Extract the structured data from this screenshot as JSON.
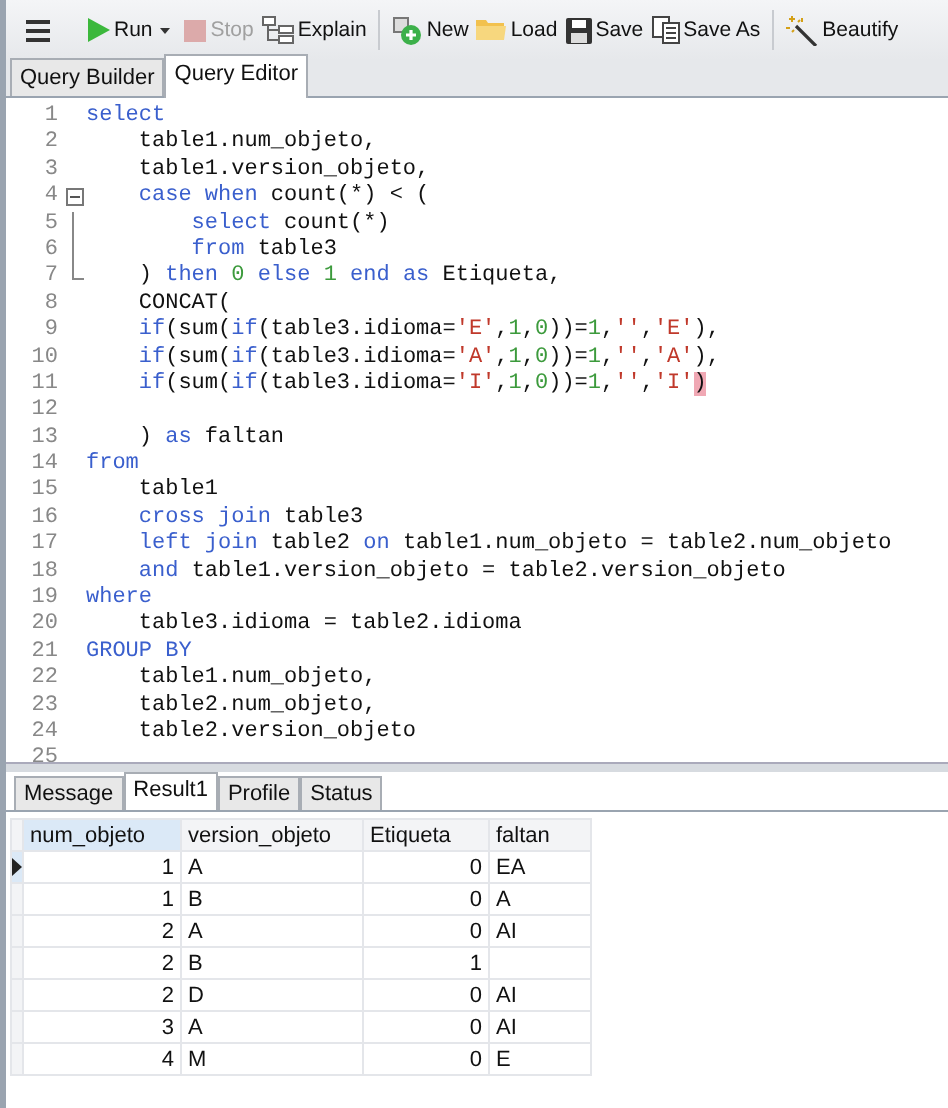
{
  "toolbar": {
    "items": [
      {
        "kind": "menu"
      },
      {
        "kind": "run",
        "label": "Run",
        "disabled": false
      },
      {
        "kind": "stop",
        "label": "Stop",
        "disabled": true
      },
      {
        "kind": "explain",
        "label": "Explain",
        "disabled": false
      },
      {
        "kind": "separator"
      },
      {
        "kind": "new",
        "label": "New",
        "disabled": false
      },
      {
        "kind": "load",
        "label": "Load",
        "disabled": false
      },
      {
        "kind": "save",
        "label": "Save",
        "disabled": false
      },
      {
        "kind": "saveas",
        "label": "Save As",
        "disabled": false
      },
      {
        "kind": "separator"
      },
      {
        "kind": "beautify",
        "label": "Beautify",
        "disabled": false
      }
    ]
  },
  "tabs": [
    {
      "label": "Query Builder",
      "selected": false
    },
    {
      "label": "Query Editor",
      "selected": true
    }
  ],
  "editor": {
    "lines": [
      {
        "number": "1",
        "segments": [
          {
            "kind": "keyword",
            "text": "select"
          }
        ]
      },
      {
        "number": "2",
        "segments": [
          {
            "kind": "plain",
            "text": "    table1.num_objeto,"
          }
        ]
      },
      {
        "number": "3",
        "segments": [
          {
            "kind": "plain",
            "text": "    table1.version_objeto,"
          }
        ]
      },
      {
        "number": "4",
        "expanded": true,
        "segments": [
          {
            "kind": "keyword",
            "text": "    case when"
          },
          {
            "kind": "plain",
            "text": " count(*) < ("
          }
        ],
        "children": [
          {
            "number": "5",
            "segments": [
              {
                "kind": "keyword",
                "text": "        select"
              },
              {
                "kind": "plain",
                "text": " count(*)"
              }
            ]
          },
          {
            "number": "6",
            "segments": [
              {
                "kind": "keyword",
                "text": "        from"
              },
              {
                "kind": "plain",
                "text": " table3"
              }
            ]
          },
          {
            "number": "7",
            "segments": [
              {
                "kind": "plain",
                "text": "    ) "
              },
              {
                "kind": "keyword",
                "text": "then "
              },
              {
                "kind": "number",
                "text": "0 "
              },
              {
                "kind": "keyword",
                "text": "else "
              },
              {
                "kind": "number",
                "text": "1 "
              },
              {
                "kind": "keyword",
                "text": "end as"
              },
              {
                "kind": "plain",
                "text": " Etiqueta,"
              }
            ]
          }
        ]
      },
      {
        "number": "8",
        "segments": [
          {
            "kind": "plain",
            "text": "    CONCAT("
          }
        ]
      },
      {
        "number": "9",
        "segments": [
          {
            "kind": "keyword",
            "text": "    if"
          },
          {
            "kind": "plain",
            "text": "(sum("
          },
          {
            "kind": "keyword",
            "text": "if"
          },
          {
            "kind": "plain",
            "text": "(table3.idioma="
          },
          {
            "kind": "string",
            "text": "'E'"
          },
          {
            "kind": "plain",
            "text": ","
          },
          {
            "kind": "number",
            "text": "1"
          },
          {
            "kind": "plain",
            "text": ","
          },
          {
            "kind": "number",
            "text": "0"
          },
          {
            "kind": "plain",
            "text": "))="
          },
          {
            "kind": "number",
            "text": "1"
          },
          {
            "kind": "plain",
            "text": ","
          },
          {
            "kind": "string",
            "text": "''"
          },
          {
            "kind": "plain",
            "text": ","
          },
          {
            "kind": "string",
            "text": "'E'"
          },
          {
            "kind": "plain",
            "text": "),"
          }
        ]
      },
      {
        "number": "10",
        "segments": [
          {
            "kind": "keyword",
            "text": "    if"
          },
          {
            "kind": "plain",
            "text": "(sum("
          },
          {
            "kind": "keyword",
            "text": "if"
          },
          {
            "kind": "plain",
            "text": "(table3.idioma="
          },
          {
            "kind": "string",
            "text": "'A'"
          },
          {
            "kind": "plain",
            "text": ","
          },
          {
            "kind": "number",
            "text": "1"
          },
          {
            "kind": "plain",
            "text": ","
          },
          {
            "kind": "number",
            "text": "0"
          },
          {
            "kind": "plain",
            "text": "))="
          },
          {
            "kind": "number",
            "text": "1"
          },
          {
            "kind": "plain",
            "text": ","
          },
          {
            "kind": "string",
            "text": "''"
          },
          {
            "kind": "plain",
            "text": ","
          },
          {
            "kind": "string",
            "text": "'A'"
          },
          {
            "kind": "plain",
            "text": "),"
          }
        ]
      },
      {
        "number": "11",
        "segments": [
          {
            "kind": "keyword",
            "text": "    if"
          },
          {
            "kind": "plain",
            "text": "(sum("
          },
          {
            "kind": "keyword",
            "text": "if"
          },
          {
            "kind": "plain",
            "text": "(table3.idioma="
          },
          {
            "kind": "string",
            "text": "'I'"
          },
          {
            "kind": "plain",
            "text": ","
          },
          {
            "kind": "number",
            "text": "1"
          },
          {
            "kind": "plain",
            "text": ","
          },
          {
            "kind": "number",
            "text": "0"
          },
          {
            "kind": "plain",
            "text": "))="
          },
          {
            "kind": "number",
            "text": "1"
          },
          {
            "kind": "plain",
            "text": ","
          },
          {
            "kind": "string",
            "text": "''"
          },
          {
            "kind": "plain",
            "text": ","
          },
          {
            "kind": "string",
            "text": "'I'"
          },
          {
            "kind": "match",
            "text": ")"
          }
        ]
      },
      {
        "number": "12"
      },
      {
        "number": "13",
        "segments": [
          {
            "kind": "plain",
            "text": "    ) "
          },
          {
            "kind": "keyword",
            "text": "as"
          },
          {
            "kind": "plain",
            "text": " faltan"
          }
        ]
      },
      {
        "number": "14",
        "segments": [
          {
            "kind": "keyword",
            "text": "from"
          }
        ]
      },
      {
        "number": "15",
        "segments": [
          {
            "kind": "plain",
            "text": "    table1"
          }
        ]
      },
      {
        "number": "16",
        "segments": [
          {
            "kind": "keyword",
            "text": "    cross join"
          },
          {
            "kind": "plain",
            "text": " table3"
          }
        ]
      },
      {
        "number": "17",
        "segments": [
          {
            "kind": "keyword",
            "text": "    left join"
          },
          {
            "kind": "plain",
            "text": " table2 "
          },
          {
            "kind": "keyword",
            "text": "on"
          },
          {
            "kind": "plain",
            "text": " table1.num_objeto = table2.num_objeto"
          }
        ]
      },
      {
        "number": "18",
        "segments": [
          {
            "kind": "keyword",
            "text": "    and"
          },
          {
            "kind": "plain",
            "text": " table1.version_objeto = table2.version_objeto"
          }
        ]
      },
      {
        "number": "19",
        "segments": [
          {
            "kind": "keyword",
            "text": "where"
          }
        ]
      },
      {
        "number": "20",
        "segments": [
          {
            "kind": "plain",
            "text": "    table3.idioma = table2.idioma"
          }
        ]
      },
      {
        "number": "21",
        "segments": [
          {
            "kind": "keyword",
            "text": "GROUP BY"
          }
        ]
      },
      {
        "number": "22",
        "segments": [
          {
            "kind": "plain",
            "text": "    table1.num_objeto,"
          }
        ]
      },
      {
        "number": "23",
        "segments": [
          {
            "kind": "plain",
            "text": "    table2.num_objeto,"
          }
        ]
      },
      {
        "number": "24",
        "segments": [
          {
            "kind": "plain",
            "text": "    table2.version_objeto"
          }
        ]
      },
      {
        "number": "25"
      }
    ]
  },
  "result_tabs": [
    {
      "label": "Message",
      "selected": false
    },
    {
      "label": "Result1",
      "selected": true
    },
    {
      "label": "Profile",
      "selected": false
    },
    {
      "label": "Status",
      "selected": false
    }
  ],
  "grid": {
    "columns": [
      {
        "label": "num_objeto",
        "selected": true
      },
      {
        "label": "version_objeto",
        "selected": false
      },
      {
        "label": "Etiqueta",
        "selected": false
      },
      {
        "label": "faltan",
        "selected": false
      }
    ],
    "rows": [
      {
        "selected": true,
        "cells": [
          "1",
          "A",
          "0",
          "EA"
        ]
      },
      {
        "selected": false,
        "cells": [
          "1",
          "B",
          "0",
          "A"
        ]
      },
      {
        "selected": false,
        "cells": [
          "2",
          "A",
          "0",
          "AI"
        ]
      },
      {
        "selected": false,
        "cells": [
          "2",
          "B",
          "1",
          ""
        ]
      },
      {
        "selected": false,
        "cells": [
          "2",
          "D",
          "0",
          "AI"
        ]
      },
      {
        "selected": false,
        "cells": [
          "3",
          "A",
          "0",
          "AI"
        ]
      },
      {
        "selected": false,
        "cells": [
          "4",
          "M",
          "0",
          "E"
        ]
      }
    ]
  }
}
